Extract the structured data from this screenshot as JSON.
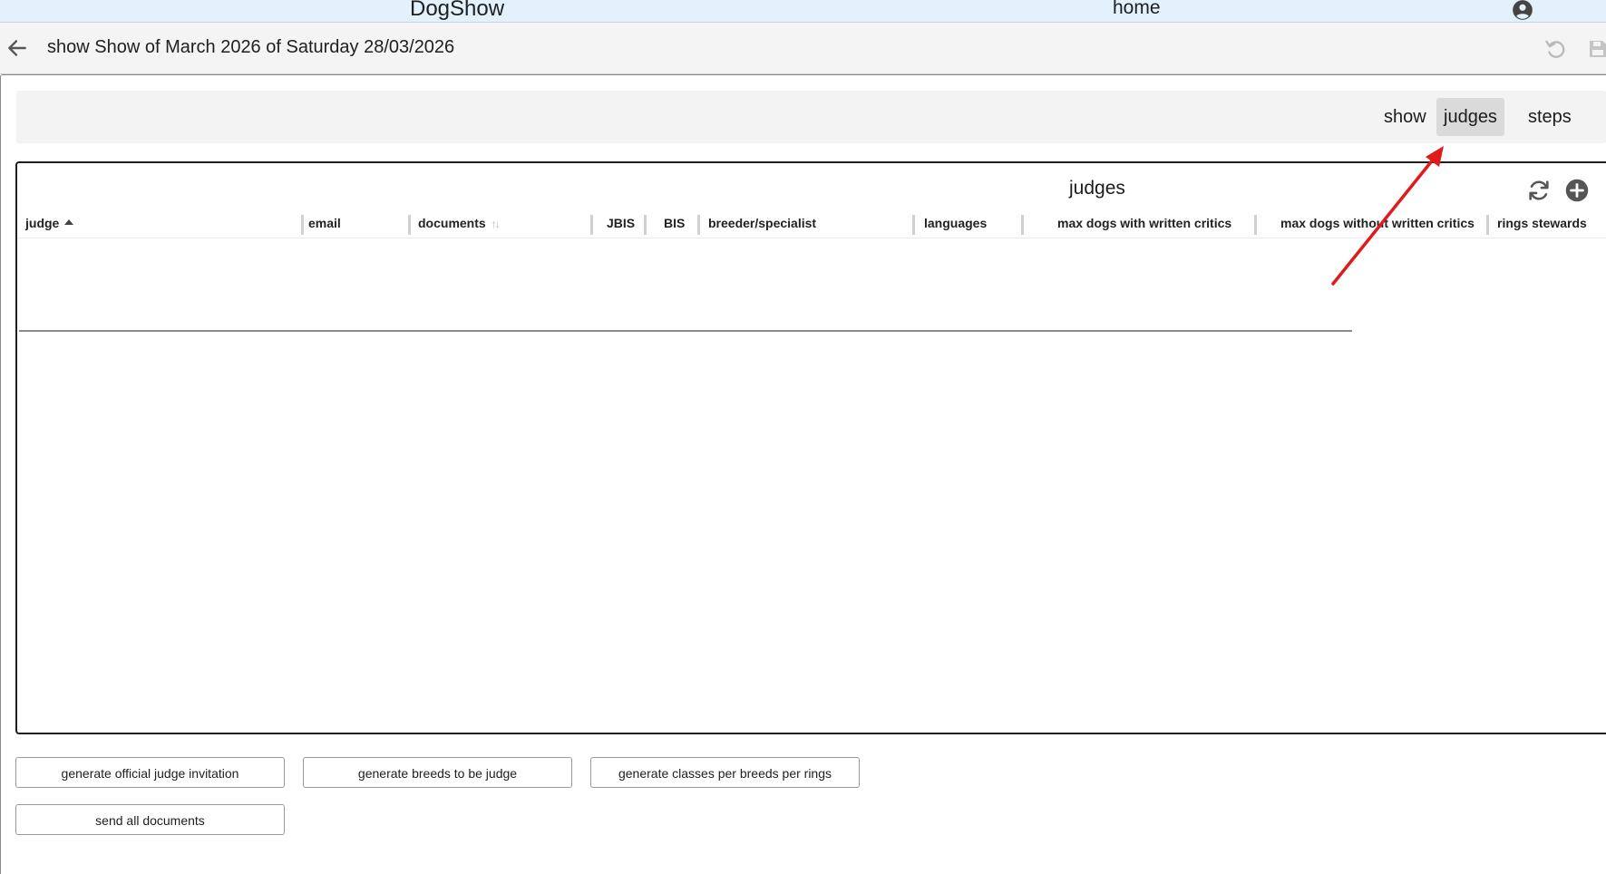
{
  "topbar": {
    "app_title": "DogShow",
    "home_label": "home",
    "account_icon": "account-circle-icon"
  },
  "subheader": {
    "title": "show Show of March 2026 of Saturday 28/03/2026",
    "back_icon": "arrow-left-icon",
    "undo_icon": "undo-icon",
    "save_icon": "save-icon"
  },
  "tabs": [
    {
      "label": "show",
      "active": false
    },
    {
      "label": "judges",
      "active": true
    },
    {
      "label": "steps",
      "active": false
    }
  ],
  "panel": {
    "title": "judges",
    "refresh_icon": "refresh-icon",
    "add_icon": "add-circle-icon",
    "columns": [
      {
        "label": "judge",
        "sort": "ascending"
      },
      {
        "label": "email"
      },
      {
        "label": "documents",
        "sort": "sortable"
      },
      {
        "label": "JBIS"
      },
      {
        "label": "BIS"
      },
      {
        "label": "breeder/specialist"
      },
      {
        "label": "languages"
      },
      {
        "label": "max dogs with written critics"
      },
      {
        "label": "max dogs without written critics"
      },
      {
        "label": "rings stewards"
      }
    ],
    "rows": []
  },
  "actions": {
    "generate_invitation": "generate official judge invitation",
    "generate_breeds": "generate breeds to be judge",
    "generate_classes": "generate classes per breeds per rings",
    "send_all": "send all documents"
  },
  "colors": {
    "topbar_bg": "#e3f1fc",
    "subheader_bg": "#f4f4f4",
    "active_tab_bg": "#dadada",
    "annotation_arrow": "#e01b1b"
  }
}
